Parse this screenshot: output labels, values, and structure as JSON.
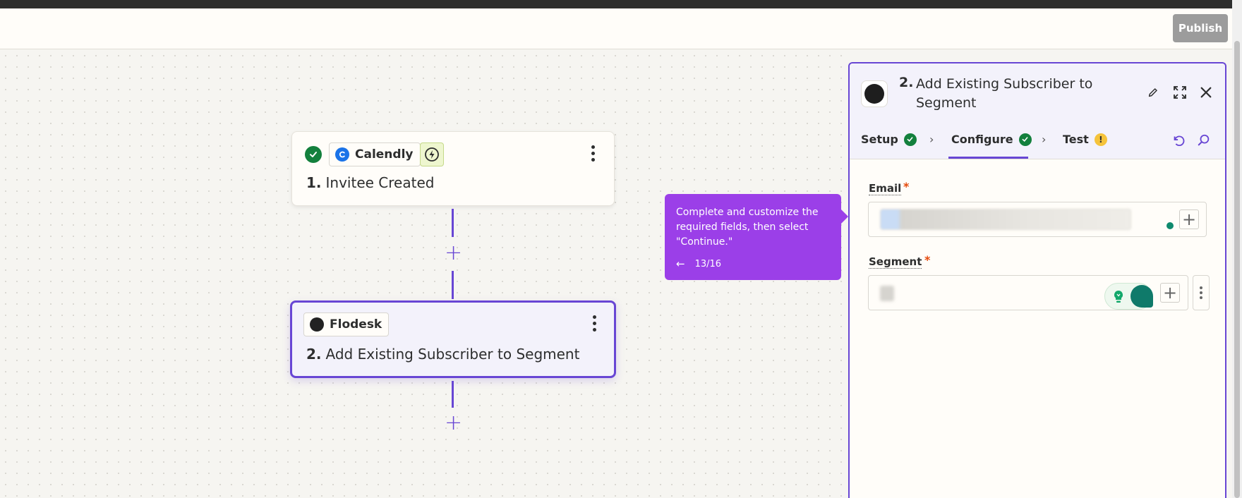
{
  "header": {
    "publish_label": "Publish"
  },
  "steps": [
    {
      "app": "Calendly",
      "number": "1.",
      "title": "Invitee Created",
      "status": "complete"
    },
    {
      "app": "Flodesk",
      "number": "2.",
      "title": "Add Existing Subscriber to Segment",
      "selected": true
    }
  ],
  "tooltip": {
    "text": "Complete and customize the required fields, then select \"Continue.\"",
    "back_icon": "arrow-left-icon",
    "progress": "13/16"
  },
  "panel": {
    "step_number": "2.",
    "title": "Add Existing Subscriber to Segment",
    "tabs": [
      {
        "label": "Setup",
        "status": "complete"
      },
      {
        "label": "Configure",
        "status": "complete",
        "active": true
      },
      {
        "label": "Test",
        "status": "warning",
        "badge": "!"
      }
    ],
    "fields": [
      {
        "label": "Email",
        "required_mark": "*"
      },
      {
        "label": "Segment",
        "required_mark": "*"
      }
    ]
  },
  "colors": {
    "accent": "#6846d4",
    "tooltip": "#9b3fe8",
    "success": "#13803d",
    "warning": "#f5c33b",
    "required": "#e5480a"
  }
}
